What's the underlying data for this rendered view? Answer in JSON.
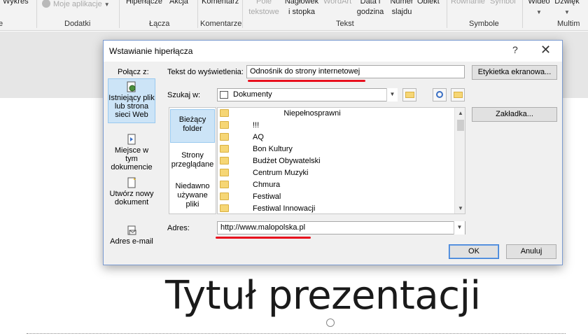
{
  "ribbon": {
    "items": {
      "wykres": "Wykres",
      "moje_aplikacje": "Moje aplikacje",
      "hiperlacze": "Hiperłącze",
      "akcja": "Akcja",
      "komentarz": "Komentarz",
      "pole_tekstowe": "Pole\ntekstowe",
      "naglowek": "Nagłówek\ni stopka",
      "wordart": "WordArt",
      "data": "Data i\ngodzina",
      "numer": "Numer\nslajdu",
      "obiekt": "Obiekt",
      "rownanie": "Równanie",
      "symbol": "Symbol",
      "wideo": "Wideo",
      "dzwiek": "Dźwięk"
    },
    "groups": {
      "dodatki": "Dodatki",
      "lacza": "Łącza",
      "komentarze": "Komentarze",
      "tekst": "Tekst",
      "symbole": "Symbole",
      "multimedia": "Multim"
    }
  },
  "slide": {
    "title": "Tytuł prezentacji"
  },
  "dialog": {
    "title": "Wstawianie hiperłącza",
    "help": "?",
    "close": "✕",
    "link_to_label": "Połącz z:",
    "display_text_label": "Tekst do wyświetlenia:",
    "display_text_value": "Odnośnik do strony internetowej",
    "screentip_button": "Etykietka ekranowa...",
    "look_in_label": "Szukaj w:",
    "look_in_value": "Dokumenty",
    "bookmark_button": "Zakładka...",
    "address_label": "Adres:",
    "address_value": "http://www.malopolska.pl",
    "ok_button": "OK",
    "cancel_button": "Anuluj",
    "sidebar": [
      {
        "label": "Istniejący plik lub strona sieci Web",
        "active": true
      },
      {
        "label": "Miejsce w tym dokumencie",
        "active": false
      },
      {
        "label": "Utwórz nowy dokument",
        "active": false
      },
      {
        "label": "Adres e-mail",
        "active": false
      }
    ],
    "nav": [
      {
        "label": "Bieżący folder",
        "active": true
      },
      {
        "label": "Strony przeglądane",
        "active": false
      },
      {
        "label": "Niedawno używane pliki",
        "active": false
      }
    ],
    "files": [
      "Niepełnosprawni",
      "!!!",
      "AQ",
      "Bon Kultury",
      "Budżet Obywatelski",
      "Centrum Muzyki",
      "Chmura",
      "Festiwal",
      "Festiwal Innowacji"
    ]
  },
  "colors": {
    "accent_selected": "#cce4f7",
    "annotation_red": "#e8101e",
    "folder": "#f6d675"
  }
}
